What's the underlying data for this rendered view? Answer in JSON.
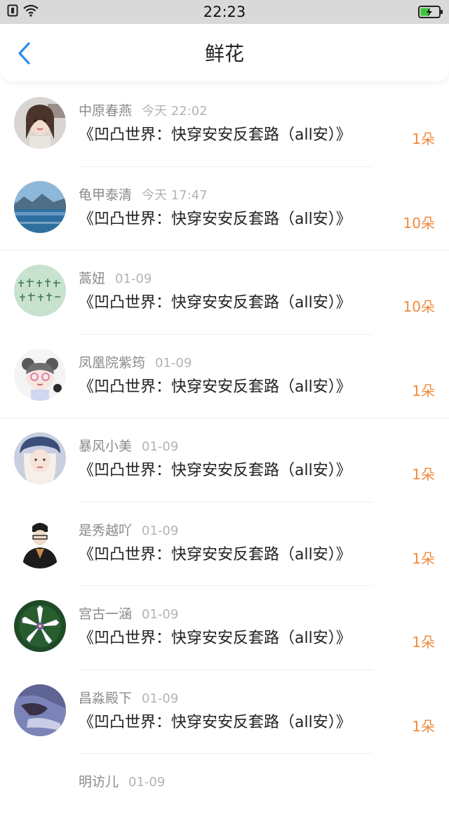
{
  "status_bar": {
    "time": "22:23"
  },
  "nav": {
    "title": "鲜花"
  },
  "items": [
    {
      "user": "中原春燕",
      "time": "今天 22:02",
      "book": "《凹凸世界：快穿安安反套路（all安）》",
      "count": "1朵"
    },
    {
      "user": "龟甲泰清",
      "time": "今天 17:47",
      "book": "《凹凸世界：快穿安安反套路（all安）》",
      "count": "10朵"
    },
    {
      "user": "蒿妞",
      "time": "01-09",
      "book": "《凹凸世界：快穿安安反套路（all安）》",
      "count": "10朵"
    },
    {
      "user": "凤凰院紫筠",
      "time": "01-09",
      "book": "《凹凸世界：快穿安安反套路（all安）》",
      "count": "1朵"
    },
    {
      "user": "暴风小美",
      "time": "01-09",
      "book": "《凹凸世界：快穿安安反套路（all安）》",
      "count": "1朵"
    },
    {
      "user": "是秀越吖",
      "time": "01-09",
      "book": "《凹凸世界：快穿安安反套路（all安）》",
      "count": "1朵"
    },
    {
      "user": "宫古一涵",
      "time": "01-09",
      "book": "《凹凸世界：快穿安安反套路（all安）》",
      "count": "1朵"
    },
    {
      "user": "昌淼殿下",
      "time": "01-09",
      "book": "《凹凸世界：快穿安安反套路（all安）》",
      "count": "1朵"
    },
    {
      "user": "明访儿",
      "time": "01-09",
      "book": "",
      "count": ""
    }
  ],
  "colors": {
    "accent": "#2d8cf0",
    "count": "#f08a3c"
  }
}
